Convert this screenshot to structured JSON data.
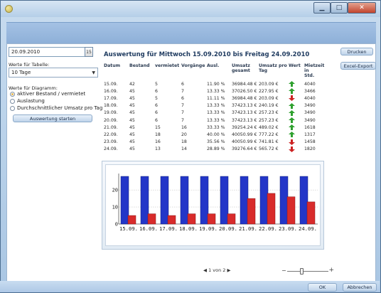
{
  "left": {
    "date_value": "20.09.2010",
    "calendar_label": "15",
    "table_label": "Werte für Tabelle:",
    "table_select": "10 Tage",
    "chart_label": "Werte für Diagramm:",
    "radio1": "aktiver Bestand / vermietet",
    "radio2": "Auslastung",
    "radio3": "Durchschnittlicher Umsatz pro Tag",
    "start_button": "Auswertung starten"
  },
  "header": {
    "title": "Auswertung für Mittwoch 15.09.2010 bis Freitag 24.09.2010"
  },
  "toolbar": {
    "print": "Drucken",
    "excel": "Excel-Export"
  },
  "table": {
    "columns": [
      "Datum",
      "Bestand",
      "vermietet",
      "Vorgänge",
      "Ausl.",
      "Umsatz\ngesamt",
      "Umsatz pro\nTag",
      "Wert",
      "Mietzeit in\nStd."
    ],
    "rows": [
      {
        "datum": "15.09.",
        "bestand": "42",
        "vermietet": "5",
        "vorgaenge": "6",
        "ausl": "11.90 %",
        "umsatz": "36984.48 €",
        "umsatz_tag": "203.09 €",
        "wert": "up",
        "mietzeit": "4040"
      },
      {
        "datum": "16.09.",
        "bestand": "45",
        "vermietet": "6",
        "vorgaenge": "7",
        "ausl": "13.33 %",
        "umsatz": "37026.50 €",
        "umsatz_tag": "227.95 €",
        "wert": "up",
        "mietzeit": "3466"
      },
      {
        "datum": "17.09.",
        "bestand": "45",
        "vermietet": "5",
        "vorgaenge": "6",
        "ausl": "11.11 %",
        "umsatz": "36984.48 €",
        "umsatz_tag": "203.09 €",
        "wert": "down",
        "mietzeit": "4040"
      },
      {
        "datum": "18.09.",
        "bestand": "45",
        "vermietet": "6",
        "vorgaenge": "7",
        "ausl": "13.33 %",
        "umsatz": "37423.13 €",
        "umsatz_tag": "240.19 €",
        "wert": "up",
        "mietzeit": "3490"
      },
      {
        "datum": "19.09.",
        "bestand": "45",
        "vermietet": "6",
        "vorgaenge": "7",
        "ausl": "13.33 %",
        "umsatz": "37423.13 €",
        "umsatz_tag": "257.23 €",
        "wert": "up",
        "mietzeit": "3490"
      },
      {
        "datum": "20.09.",
        "bestand": "45",
        "vermietet": "6",
        "vorgaenge": "7",
        "ausl": "13.33 %",
        "umsatz": "37423.13 €",
        "umsatz_tag": "257.23 €",
        "wert": "up",
        "mietzeit": "3490"
      },
      {
        "datum": "21.09.",
        "bestand": "45",
        "vermietet": "15",
        "vorgaenge": "16",
        "ausl": "33.33 %",
        "umsatz": "39254.24 €",
        "umsatz_tag": "489.02 €",
        "wert": "up",
        "mietzeit": "1618"
      },
      {
        "datum": "22.09.",
        "bestand": "45",
        "vermietet": "18",
        "vorgaenge": "20",
        "ausl": "40.00 %",
        "umsatz": "40050.99 €",
        "umsatz_tag": "777.22 €",
        "wert": "up",
        "mietzeit": "1317"
      },
      {
        "datum": "23.09.",
        "bestand": "45",
        "vermietet": "16",
        "vorgaenge": "18",
        "ausl": "35.56 %",
        "umsatz": "40050.99 €",
        "umsatz_tag": "741.81 €",
        "wert": "down",
        "mietzeit": "1458"
      },
      {
        "datum": "24.09.",
        "bestand": "45",
        "vermietet": "13",
        "vorgaenge": "14",
        "ausl": "28.89 %",
        "umsatz": "39276.64 €",
        "umsatz_tag": "565.72 €",
        "wert": "down",
        "mietzeit": "1820"
      }
    ]
  },
  "colors": {
    "up": "#2fa02f",
    "down": "#cc2222",
    "bar_blue": "#2336c8",
    "bar_red": "#d82b2b"
  },
  "pager": {
    "prev": "◀",
    "label": "1 von 2",
    "next": "▶"
  },
  "footer": {
    "ok": "OK",
    "cancel": "Abbrechen"
  },
  "chart_data": {
    "type": "bar",
    "categories": [
      "15.09.",
      "16.09.",
      "17.09.",
      "18.09.",
      "19.09.",
      "20.09.",
      "21.09.",
      "22.09.",
      "23.09.",
      "24.09."
    ],
    "series": [
      {
        "values": [
          42,
          45,
          45,
          45,
          45,
          45,
          45,
          45,
          45,
          45
        ]
      },
      {
        "values": [
          5,
          6,
          5,
          6,
          6,
          6,
          15,
          18,
          16,
          13
        ]
      }
    ],
    "yticks": [
      "0",
      "10",
      "20"
    ],
    "ylim": [
      0,
      28
    ],
    "grid": true
  }
}
